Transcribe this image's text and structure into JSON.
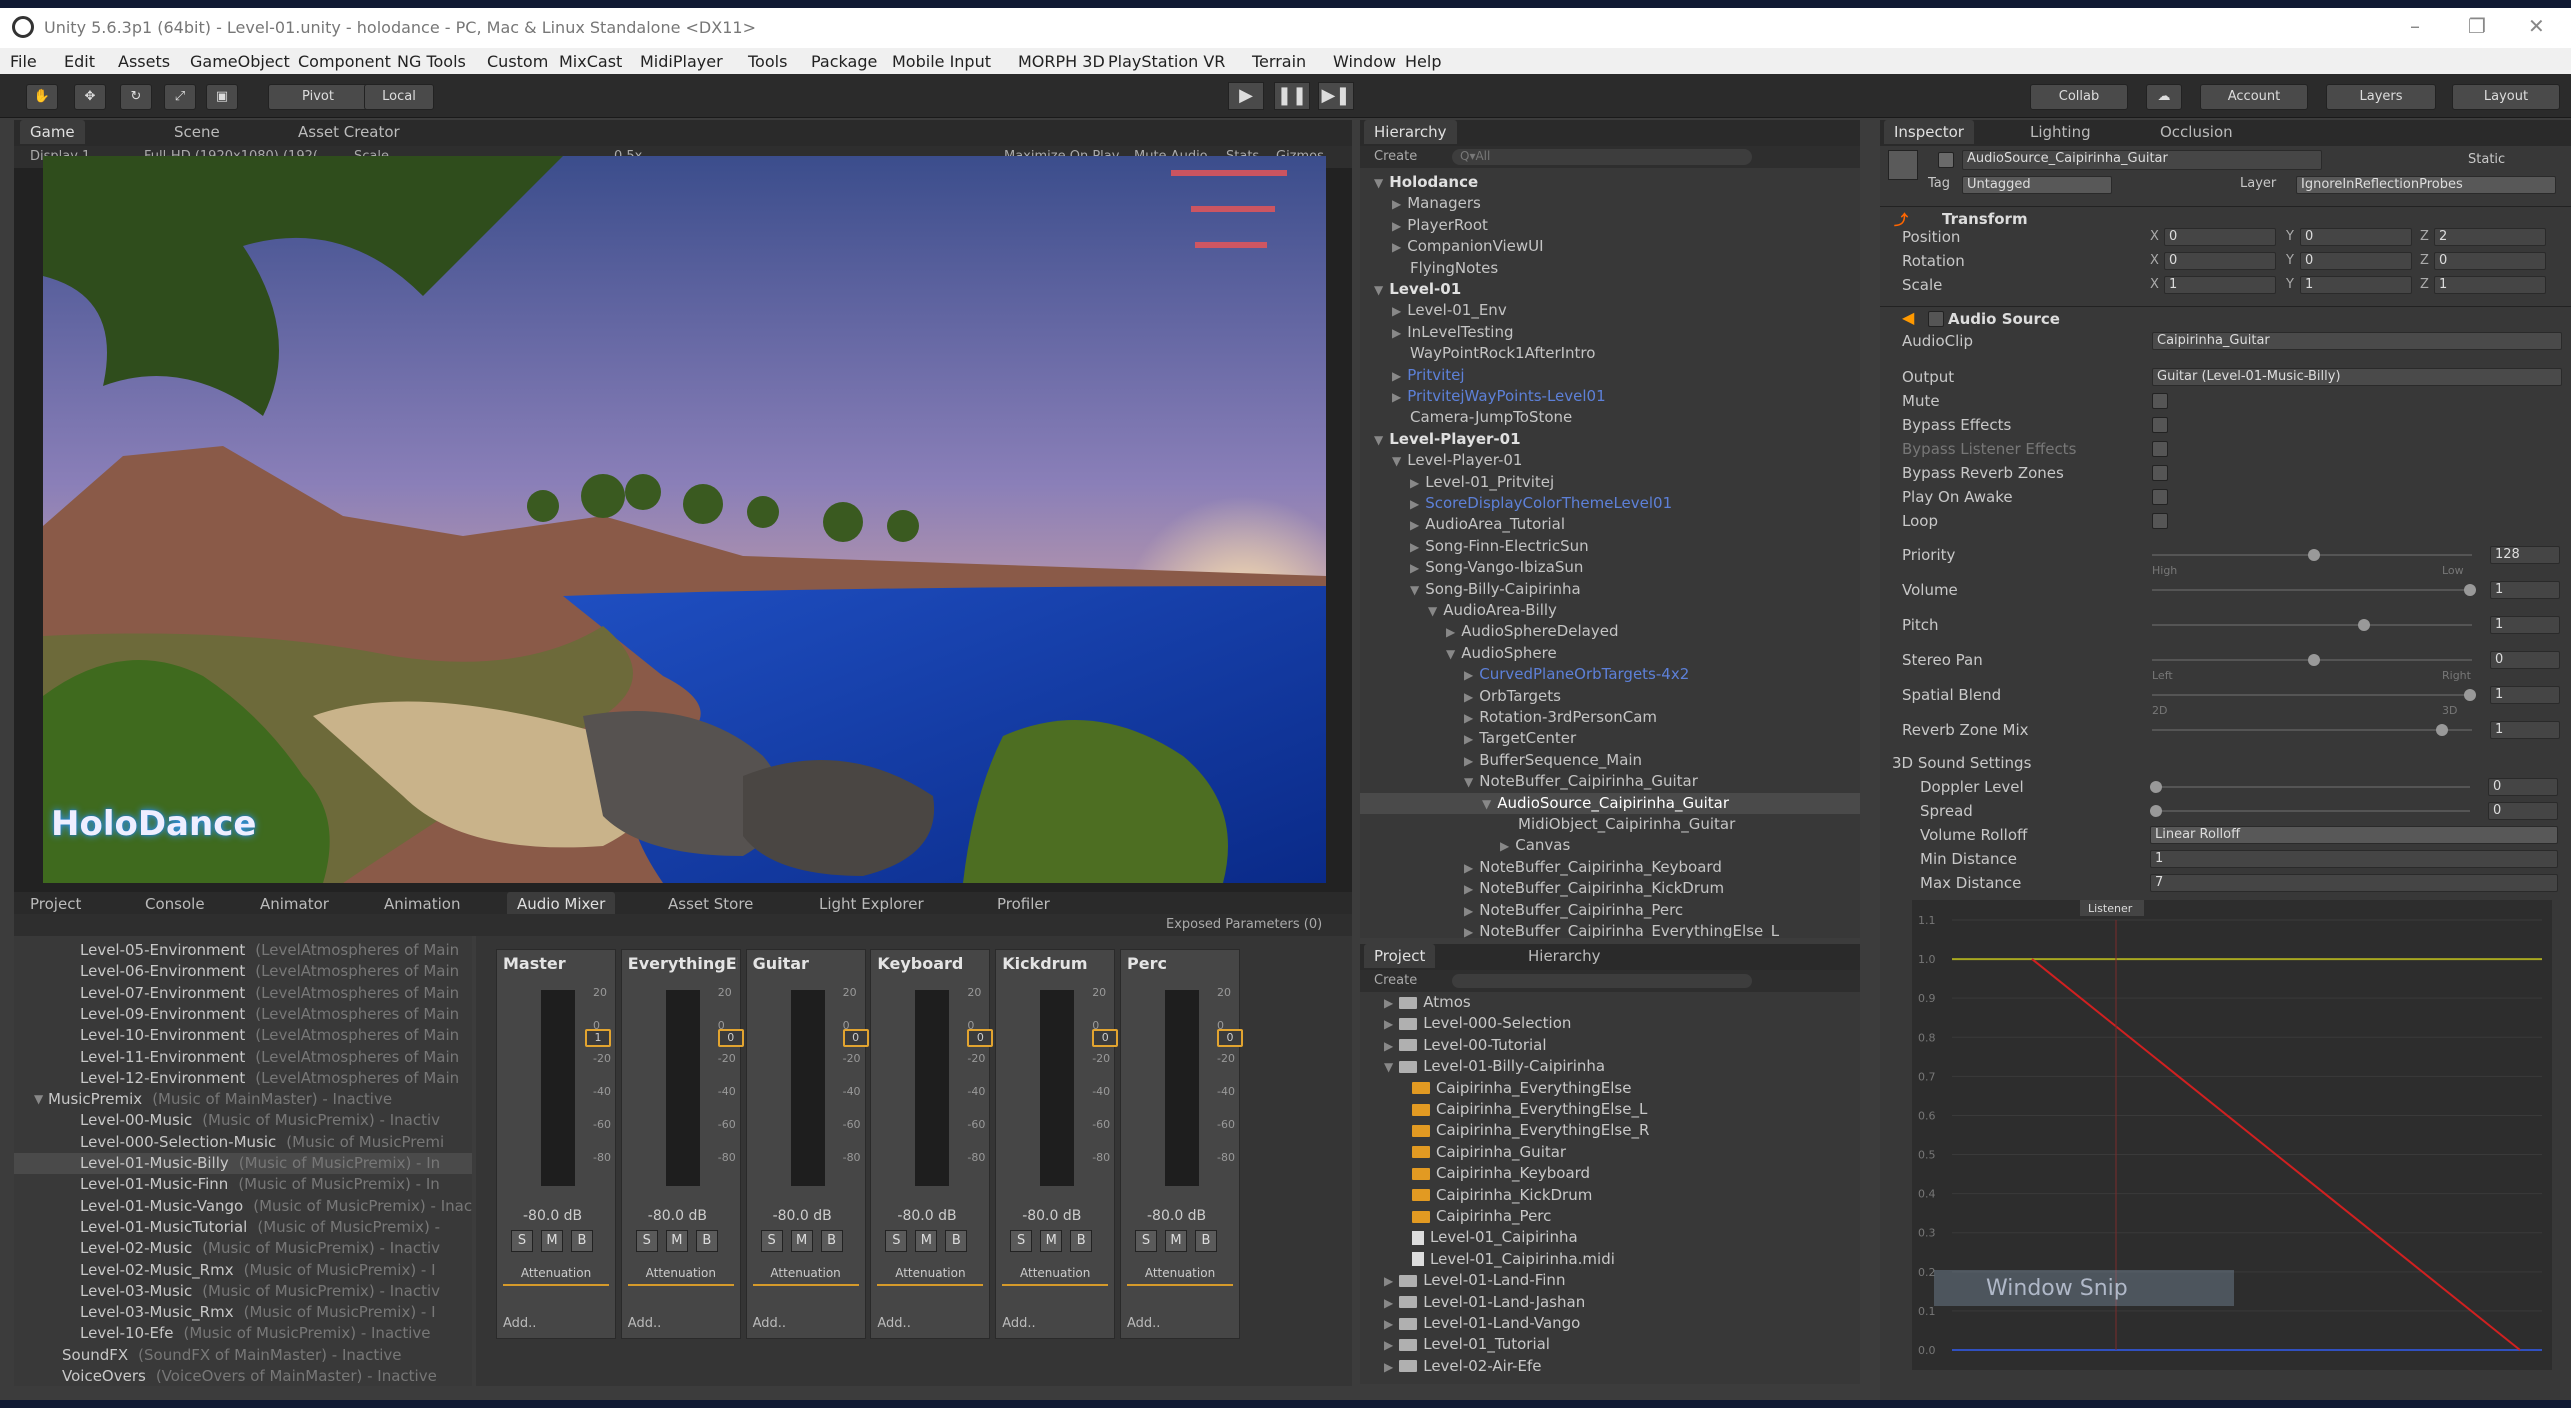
{
  "window": {
    "title": "Unity 5.6.3p1 (64bit) - Level-01.unity - holodance - PC, Mac & Linux Standalone <DX11>",
    "minimize": "–",
    "restore": "❐",
    "close": "✕"
  },
  "menu": [
    "File",
    "Edit",
    "Assets",
    "GameObject",
    "Component",
    "NG Tools",
    "Custom",
    "MixCast",
    "MidiPlayer",
    "Tools",
    "Package",
    "Mobile Input",
    "MORPH 3D",
    "PlayStation VR",
    "Terrain",
    "Window",
    "Help"
  ],
  "toolbar": {
    "pivot": "Pivot",
    "local": "Local",
    "play": "▶",
    "pause": "❚❚",
    "step": "▶❚",
    "collab": "Collab",
    "account": "Account",
    "layers": "Layers",
    "layout": "Layout"
  },
  "game_tabs": [
    "Game",
    "Scene",
    "Asset Creator"
  ],
  "game_bar": {
    "display": "Display 1",
    "resolution": "Full-HD (1920x1080) (192(",
    "scale_label": "Scale",
    "scale_value": "0.5x",
    "maximize": "Maximize On Play",
    "mute": "Mute Audio",
    "stats": "Stats",
    "gizmos": "Gizmos"
  },
  "game_overlay": {
    "logo": "HoloDance"
  },
  "hierarchy": {
    "tab": "Hierarchy",
    "create": "Create",
    "search": "Q▾All",
    "items": [
      {
        "t": "Holodance",
        "d": 0,
        "s": "root"
      },
      {
        "t": "Managers",
        "d": 1
      },
      {
        "t": "PlayerRoot",
        "d": 1
      },
      {
        "t": "CompanionViewUI",
        "d": 1
      },
      {
        "t": "FlyingNotes",
        "d": 1,
        "s": "noarr"
      },
      {
        "t": "Level-01",
        "d": 0,
        "s": "root"
      },
      {
        "t": "Level-01_Env",
        "d": 1
      },
      {
        "t": "InLevelTesting",
        "d": 1
      },
      {
        "t": "WayPointRock1AfterIntro",
        "d": 1,
        "s": "noarr"
      },
      {
        "t": "Pritvitej",
        "d": 1,
        "s": "blue"
      },
      {
        "t": "PritvitejWayPoints-Level01",
        "d": 1,
        "s": "blue"
      },
      {
        "t": "Camera-JumpToStone",
        "d": 1,
        "s": "noarr"
      },
      {
        "t": "Level-Player-01",
        "d": 0,
        "s": "root"
      },
      {
        "t": "Level-Player-01",
        "d": 1,
        "o": 1
      },
      {
        "t": "Level-01_Pritvitej",
        "d": 2
      },
      {
        "t": "ScoreDisplayColorThemeLevel01",
        "d": 2,
        "s": "blue"
      },
      {
        "t": "AudioArea_Tutorial",
        "d": 2
      },
      {
        "t": "Song-Finn-ElectricSun",
        "d": 2
      },
      {
        "t": "Song-Vango-IbizaSun",
        "d": 2
      },
      {
        "t": "Song-Billy-Caipirinha",
        "d": 2,
        "o": 1
      },
      {
        "t": "AudioArea-Billy",
        "d": 3,
        "o": 1
      },
      {
        "t": "AudioSphereDelayed",
        "d": 4
      },
      {
        "t": "AudioSphere",
        "d": 4,
        "o": 1
      },
      {
        "t": "CurvedPlaneOrbTargets-4x2",
        "d": 5,
        "s": "blue"
      },
      {
        "t": "OrbTargets",
        "d": 5
      },
      {
        "t": "Rotation-3rdPersonCam",
        "d": 5
      },
      {
        "t": "TargetCenter",
        "d": 5
      },
      {
        "t": "BufferSequence_Main",
        "d": 5
      },
      {
        "t": "NoteBuffer_Caipirinha_Guitar",
        "d": 5,
        "o": 1
      },
      {
        "t": "AudioSource_Caipirinha_Guitar",
        "d": 6,
        "o": 1,
        "s": "sel"
      },
      {
        "t": "MidiObject_Caipirinha_Guitar",
        "d": 7,
        "s": "noarr"
      },
      {
        "t": "Canvas",
        "d": 7
      },
      {
        "t": "NoteBuffer_Caipirinha_Keyboard",
        "d": 5
      },
      {
        "t": "NoteBuffer_Caipirinha_KickDrum",
        "d": 5
      },
      {
        "t": "NoteBuffer_Caipirinha_Perc",
        "d": 5
      },
      {
        "t": "NoteBuffer_Caipirinha_EverythingElse_L",
        "d": 5
      }
    ]
  },
  "inspector": {
    "tabs": [
      "Inspector",
      "Lighting",
      "Occlusion"
    ],
    "object": "AudioSource_Caipirinha_Guitar",
    "static": "Static",
    "tag_label": "Tag",
    "tag": "Untagged",
    "layer_label": "Layer",
    "layer": "IgnoreInReflectionProbes",
    "transform": {
      "title": "Transform",
      "rows": [
        {
          "l": "Position",
          "x": "0",
          "y": "0",
          "z": "2"
        },
        {
          "l": "Rotation",
          "x": "0",
          "y": "0",
          "z": "0"
        },
        {
          "l": "Scale",
          "x": "1",
          "y": "1",
          "z": "1"
        }
      ]
    },
    "audio": {
      "title": "Audio Source",
      "clip_label": "AudioClip",
      "clip": "Caipirinha_Guitar",
      "output_label": "Output",
      "output": "Guitar (Level-01-Music-Billy)",
      "checks": [
        "Mute",
        "Bypass Effects",
        "Bypass Listener Effects",
        "Bypass Reverb Zones",
        "Play On Awake",
        "Loop"
      ],
      "sliders": [
        {
          "l": "Priority",
          "v": "128",
          "pos": 0.5,
          "lo": "High",
          "hi": "Low"
        },
        {
          "l": "Volume",
          "v": "1",
          "pos": 1
        },
        {
          "l": "Pitch",
          "v": "1",
          "pos": 0.66
        },
        {
          "l": "Stereo Pan",
          "v": "0",
          "pos": 0.5,
          "lo": "Left",
          "hi": "Right"
        },
        {
          "l": "Spatial Blend",
          "v": "1",
          "pos": 1,
          "lo": "2D",
          "hi": "3D"
        },
        {
          "l": "Reverb Zone Mix",
          "v": "1",
          "pos": 0.91
        }
      ],
      "sound3d": "3D Sound Settings",
      "doppler_label": "Doppler Level",
      "doppler": "0",
      "spread_label": "Spread",
      "spread": "0",
      "rolloff_label": "Volume Rolloff",
      "rolloff": "Linear Rolloff",
      "min_label": "Min Distance",
      "min": "1",
      "max_label": "Max Distance",
      "max": "7",
      "listener": "Listener",
      "yticks": [
        "1.1",
        "1.0",
        "0.9",
        "0.8",
        "0.7",
        "0.6",
        "0.5",
        "0.4",
        "0.3",
        "0.2",
        "0.1",
        "0.0"
      ],
      "snip": "Window Snip"
    }
  },
  "bottom_tabs": [
    "Project",
    "Console",
    "Animator",
    "Animation",
    "Audio Mixer",
    "Asset Store",
    "Light Explorer",
    "Profiler"
  ],
  "mixer": {
    "exposed": "Exposed Parameters (0)",
    "items": [
      {
        "n": "Level-05-Environment",
        "g": "(LevelAtmospheres of Main"
      },
      {
        "n": "Level-06-Environment",
        "g": "(LevelAtmospheres of Main"
      },
      {
        "n": "Level-07-Environment",
        "g": "(LevelAtmospheres of Main"
      },
      {
        "n": "Level-09-Environment",
        "g": "(LevelAtmospheres of Main"
      },
      {
        "n": "Level-10-Environment",
        "g": "(LevelAtmospheres of Main"
      },
      {
        "n": "Level-11-Environment",
        "g": "(LevelAtmospheres of Main"
      },
      {
        "n": "Level-12-Environment",
        "g": "(LevelAtmospheres of Main"
      },
      {
        "n": "MusicPremix",
        "g": "(Music of MainMaster) - Inactive",
        "d": 0
      },
      {
        "n": "Level-00-Music",
        "g": "(Music of MusicPremix) - Inactiv",
        "d": 1
      },
      {
        "n": "Level-000-Selection-Music",
        "g": "(Music of MusicPremi",
        "d": 1
      },
      {
        "n": "Level-01-Music-Billy",
        "g": "(Music of MusicPremix) - In",
        "d": 1,
        "sel": 1
      },
      {
        "n": "Level-01-Music-Finn",
        "g": "(Music of MusicPremix) - In",
        "d": 1
      },
      {
        "n": "Level-01-Music-Vango",
        "g": "(Music of MusicPremix) - Inac",
        "d": 1
      },
      {
        "n": "Level-01-MusicTutorial",
        "g": "(Music of MusicPremix) -",
        "d": 1
      },
      {
        "n": "Level-02-Music",
        "g": "(Music of MusicPremix) - Inactiv",
        "d": 1
      },
      {
        "n": "Level-02-Music_Rmx",
        "g": "(Music of MusicPremix) - I",
        "d": 1
      },
      {
        "n": "Level-03-Music",
        "g": "(Music of MusicPremix) - Inactiv",
        "d": 1
      },
      {
        "n": "Level-03-Music_Rmx",
        "g": "(Music of MusicPremix) - I",
        "d": 1
      },
      {
        "n": "Level-10-Efe",
        "g": "(Music of MusicPremix) - Inactive",
        "d": 1
      },
      {
        "n": "SoundFX",
        "g": "(SoundFX of MainMaster) - Inactive",
        "d": -1
      },
      {
        "n": "VoiceOvers",
        "g": "(VoiceOvers of MainMaster) - Inactive",
        "d": -1
      }
    ],
    "channels": [
      {
        "n": "Master",
        "v": "1"
      },
      {
        "n": "EverythingEl",
        "v": "0"
      },
      {
        "n": "Guitar",
        "v": "0"
      },
      {
        "n": "Keyboard",
        "v": "0"
      },
      {
        "n": "Kickdrum",
        "v": "0"
      },
      {
        "n": "Perc",
        "v": "0"
      }
    ],
    "db": "-80.0 dB",
    "s": "S",
    "m": "M",
    "b": "B",
    "att": "Attenuation",
    "add": "Add..",
    "scale": [
      "20",
      "0",
      "-20",
      "-40",
      "-60",
      "-80"
    ]
  },
  "project": {
    "tabs": [
      "Project",
      "Hierarchy"
    ],
    "create": "Create",
    "items": [
      {
        "t": "Atmos",
        "d": 0
      },
      {
        "t": "Level-000-Selection",
        "d": 0
      },
      {
        "t": "Level-00-Tutorial",
        "d": 0
      },
      {
        "t": "Level-01-Billy-Caipirinha",
        "d": 0,
        "o": 1
      },
      {
        "t": "Caipirinha_EverythingElse",
        "d": 1,
        "f": "a"
      },
      {
        "t": "Caipirinha_EverythingElse_L",
        "d": 1,
        "f": "a"
      },
      {
        "t": "Caipirinha_EverythingElse_R",
        "d": 1,
        "f": "a"
      },
      {
        "t": "Caipirinha_Guitar",
        "d": 1,
        "f": "a"
      },
      {
        "t": "Caipirinha_Keyboard",
        "d": 1,
        "f": "a"
      },
      {
        "t": "Caipirinha_KickDrum",
        "d": 1,
        "f": "a"
      },
      {
        "t": "Caipirinha_Perc",
        "d": 1,
        "f": "a"
      },
      {
        "t": "Level-01_Caipirinha",
        "d": 1,
        "f": "doc"
      },
      {
        "t": "Level-01_Caipirinha.midi",
        "d": 1,
        "f": "doc"
      },
      {
        "t": "Level-01-Land-Finn",
        "d": 0
      },
      {
        "t": "Level-01-Land-Jashan",
        "d": 0
      },
      {
        "t": "Level-01-Land-Vango",
        "d": 0
      },
      {
        "t": "Level-01_Tutorial",
        "d": 0
      },
      {
        "t": "Level-02-Air-Efe",
        "d": 0
      }
    ]
  }
}
